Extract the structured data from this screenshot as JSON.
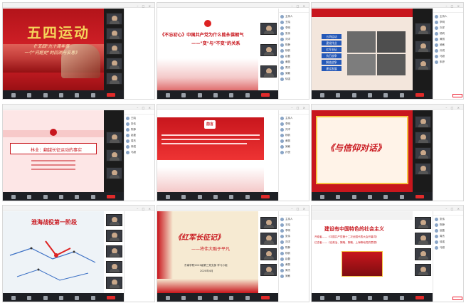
{
  "tiles": [
    {
      "id": "t1",
      "slide_title": "五四运动",
      "slide_sub1": "《\"五四\"九十周年祭",
      "slide_sub2": "一个\"问题史\"的回溯与反思》"
    },
    {
      "id": "t2",
      "slide_title": "《不忘初心》中国共产党为什么能永葆朝气",
      "slide_sub": "——\"变\"与\"不变\"的关系"
    },
    {
      "id": "t3",
      "menu": [
        "五四运动",
        "建党伟业",
        "红军长征",
        "抗日战争",
        "解放战争",
        "建设发展"
      ]
    },
    {
      "id": "t4",
      "slide_title": "林业：翻越长征运动的事实"
    },
    {
      "id": "t5",
      "slide_badge": "前言"
    },
    {
      "id": "t6",
      "slide_title": "《与信仰对话》"
    },
    {
      "id": "t7",
      "slide_title": "淮海战役第一阶段"
    },
    {
      "id": "t8",
      "slide_title": "《红军长征记》",
      "slide_sub": "——将伟大融于平凡",
      "slide_org": "东南学院2023级第三党支部 学习小组",
      "slide_date": "2020年4月"
    },
    {
      "id": "t9",
      "slide_title": "建设有中国特色的社会主义",
      "slide_line1": "开卷者——《中国共产党第十二次全国代表大会开幕词》",
      "slide_line2": "亿念者——《论政治、策略、策略、上海等地党的思想》"
    }
  ],
  "participant_names": [
    "主持人",
    "王晓",
    "李明",
    "张伟",
    "刘洋",
    "陈静",
    "杨帆",
    "赵磊",
    "黄丽",
    "周杰",
    "吴敏",
    "徐强",
    "孙悦",
    "马超",
    "朱婷"
  ],
  "colors": {
    "red": "#c8161d",
    "darkred": "#9c1016",
    "gold": "#f5c242",
    "cream": "#f6ead2"
  }
}
